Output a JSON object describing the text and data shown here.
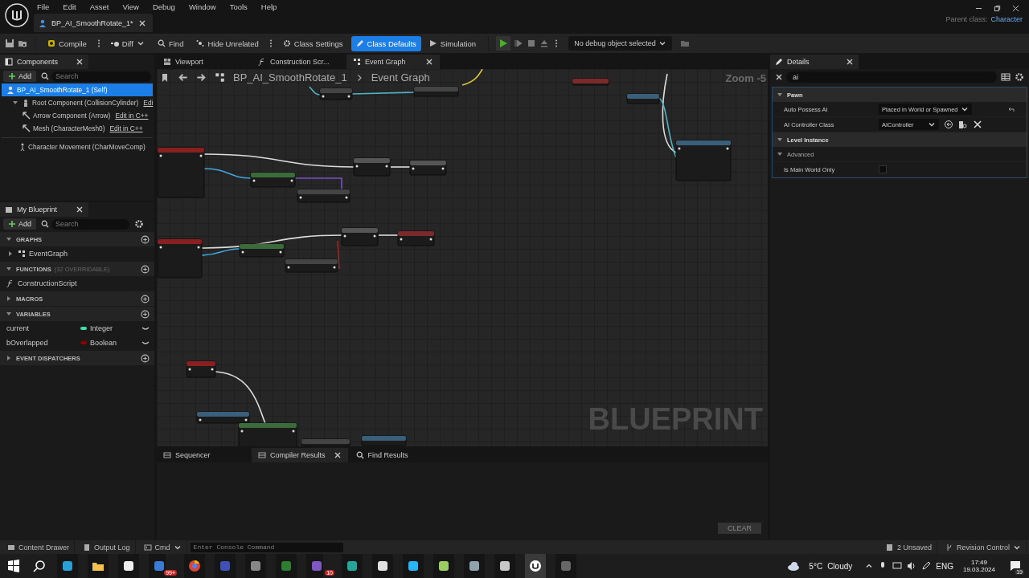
{
  "menu": [
    "File",
    "Edit",
    "Asset",
    "View",
    "Debug",
    "Window",
    "Tools",
    "Help"
  ],
  "document_tab": {
    "title": "BP_AI_SmoothRotate_1*"
  },
  "parent_class": {
    "label": "Parent class:",
    "value": "Character"
  },
  "toolbar": {
    "buttons": [
      {
        "label": "Compile",
        "kind": "compile",
        "selected": false
      },
      {
        "label": "Diff",
        "kind": "diff",
        "selected": false
      },
      {
        "label": "Find",
        "kind": "find",
        "selected": false
      },
      {
        "label": "Hide Unrelated",
        "kind": "hide",
        "selected": false
      },
      {
        "label": "Class Settings",
        "kind": "settings",
        "selected": false
      },
      {
        "label": "Class Defaults",
        "kind": "defaults",
        "selected": true
      },
      {
        "label": "Simulation",
        "kind": "simulation",
        "selected": false
      }
    ],
    "debug_selector": "No debug object selected"
  },
  "components": {
    "title": "Components",
    "add": "Add",
    "search_placeholder": "Search",
    "tree": [
      {
        "label": "BP_AI_SmoothRotate_1 (Self)",
        "selected": true,
        "children": [
          {
            "label": "Root Component (CollisionCylinder)",
            "edit": "Edi",
            "selected": false,
            "children": [
              {
                "label": "Arrow Component (Arrow)",
                "edit": "Edit in C++",
                "selected": false
              },
              {
                "label": "Mesh (CharacterMesh0)",
                "edit": "Edit in C++",
                "selected": false
              }
            ]
          }
        ]
      }
    ],
    "movement": [
      {
        "label": "Character Movement (CharMoveComp)",
        "selected": false
      }
    ]
  },
  "my_blueprint": {
    "title": "My Blueprint",
    "add": "Add",
    "search_placeholder": "Search",
    "sections": [
      {
        "title": "GRAPHS",
        "expanded": true,
        "items": [
          {
            "label": "EventGraph"
          }
        ]
      },
      {
        "title": "FUNCTIONS",
        "note": "(32 OVERRIDABLE)",
        "expanded": true,
        "items": [
          {
            "label": "ConstructionScript"
          }
        ]
      },
      {
        "title": "MACROS",
        "expanded": false
      },
      {
        "title": "VARIABLES",
        "expanded": true,
        "items": [
          {
            "label": "current",
            "type": "Integer",
            "color": "#3fe0a8"
          },
          {
            "label": "bOverlapped",
            "type": "Boolean",
            "color": "#8c0000"
          }
        ]
      },
      {
        "title": "EVENT DISPATCHERS",
        "expanded": false
      }
    ]
  },
  "editor_tabs": [
    {
      "label": "Viewport",
      "selected": false
    },
    {
      "label": "Construction Scr...",
      "selected": false
    },
    {
      "label": "Event Graph",
      "selected": true
    }
  ],
  "breadcrumb": [
    "BP_AI_SmoothRotate_1",
    "Event Graph"
  ],
  "graph": {
    "zoom": "Zoom -5",
    "watermark": "BLUEPRINT"
  },
  "bottom_tabs": [
    {
      "label": "Sequencer",
      "selected": false
    },
    {
      "label": "Compiler Results",
      "selected": true
    },
    {
      "label": "Find Results",
      "selected": false
    }
  ],
  "clear_button": {
    "label": "CLEAR",
    "disabled": true
  },
  "details": {
    "title": "Details",
    "search_value": "ai",
    "categories": [
      {
        "title": "Pawn",
        "expanded": true,
        "rows": [
          {
            "kind": "dropdown",
            "label": "Auto Possess AI",
            "value": "Placed in World or Spawned"
          },
          {
            "kind": "class",
            "label": "AI Controller Class",
            "value": "AIController"
          }
        ]
      },
      {
        "title": "Level Instance",
        "expanded": true,
        "rows": [
          {
            "kind": "subcategory",
            "label": "Advanced"
          },
          {
            "kind": "checkbox",
            "label": "Is Main World Only",
            "checked": false
          }
        ]
      }
    ]
  },
  "status_bar": {
    "content_drawer": "Content Drawer",
    "output_log": "Output Log",
    "cmd": "Cmd",
    "console_placeholder": "Enter Console Command",
    "unsaved": "2 Unsaved",
    "revision_control": "Revision Control"
  },
  "taskbar": {
    "apps": [
      {
        "selected": false
      },
      {
        "selected": false
      },
      {
        "selected": false
      },
      {
        "selected": false,
        "badge": "99+"
      },
      {
        "selected": false
      },
      {
        "selected": false
      },
      {
        "selected": false
      },
      {
        "selected": false
      },
      {
        "selected": false,
        "badge": "10"
      },
      {
        "selected": false
      },
      {
        "selected": false
      },
      {
        "selected": false
      },
      {
        "selected": false
      },
      {
        "selected": false
      },
      {
        "selected": false
      },
      {
        "selected": true
      },
      {
        "selected": false
      }
    ],
    "weather": {
      "temp": "5°C",
      "condition": "Cloudy"
    },
    "language": "ENG",
    "time": "17:49",
    "date": "19.03.2024",
    "notifications": "19"
  }
}
